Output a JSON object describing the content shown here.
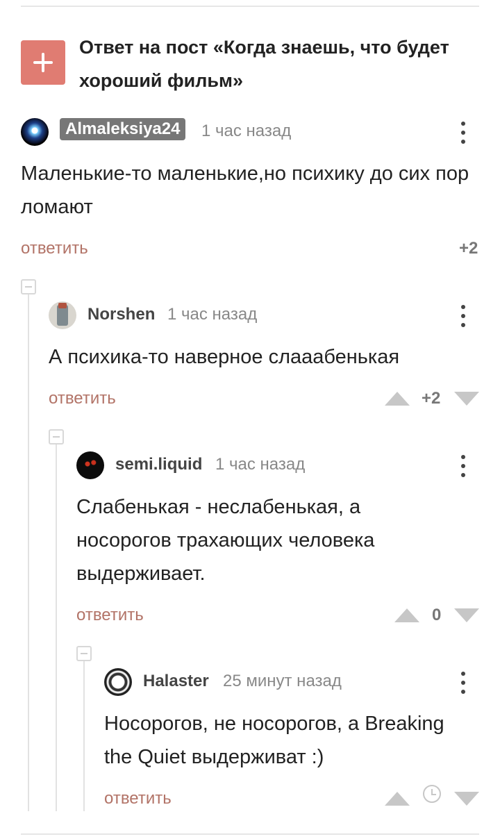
{
  "post": {
    "title": "Ответ на пост «Когда знаешь, что будет хороший фильм»"
  },
  "comments": [
    {
      "author": "Almaleksiya24",
      "time": "1 час назад",
      "text": "Маленькие-то маленькие,но психику до сих пор ломают",
      "reply_label": "ответить",
      "rating": "+2"
    },
    {
      "author": "Norshen",
      "time": "1 час назад",
      "text": "А психика-то наверное слааабенькая",
      "reply_label": "ответить",
      "rating": "+2"
    },
    {
      "author": "semi.liquid",
      "time": "1 час назад",
      "text": "Слабенькая - неслабенькая, а носорогов трахающих человека выдерживает.",
      "reply_label": "ответить",
      "rating": "0"
    },
    {
      "author": "Halaster",
      "time": "25 минут назад",
      "text": "Носорогов, не носорогов, а Breaking the Quiet выдерживат :)",
      "reply_label": "ответить"
    }
  ],
  "colors": {
    "accent": "#e07c72",
    "reply": "#b27367",
    "vote": "#c7c7c7"
  }
}
